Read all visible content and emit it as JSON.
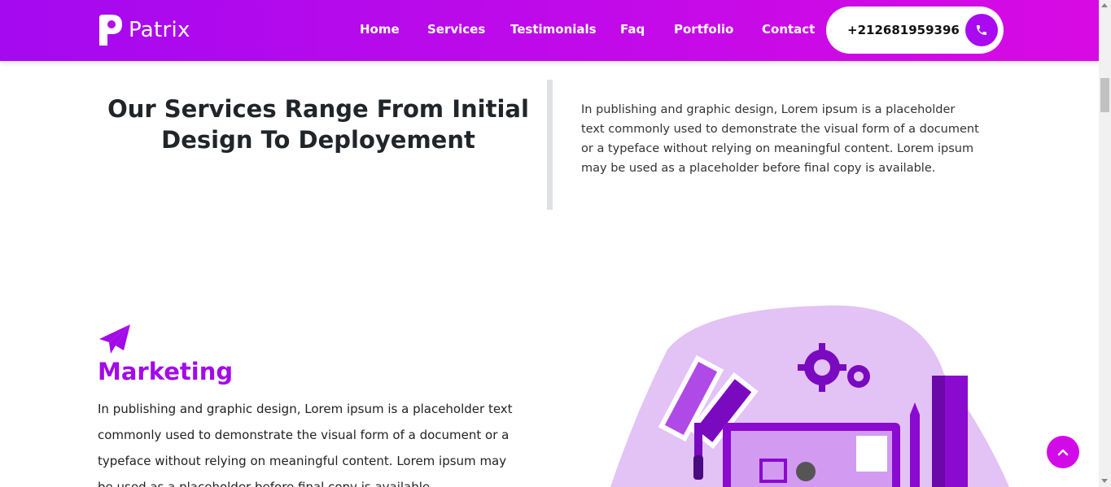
{
  "brand": {
    "name": "Patrix",
    "accent": "#a90af0",
    "accent_end": "#d80ae4"
  },
  "nav": {
    "items": [
      {
        "label": "Home"
      },
      {
        "label": "Services"
      },
      {
        "label": "Testimonials"
      },
      {
        "label": "Faq"
      },
      {
        "label": "Portfolio"
      },
      {
        "label": "Contact"
      }
    ],
    "phone": "+212681959396",
    "phone_icon": "phone-icon"
  },
  "intro": {
    "title": "Our Services Range From Initial Design To Deployement",
    "text": "In publishing and graphic design, Lorem ipsum is a placeholder text commonly used to demonstrate the visual form of a document or a typeface without relying on meaningful content. Lorem ipsum may be used as a placeholder before final copy is available."
  },
  "marketing": {
    "icon": "paper-plane-icon",
    "title": "Marketing",
    "text": "In publishing and graphic design, Lorem ipsum is a placeholder text commonly used to demonstrate the visual form of a document or a typeface without relying on meaningful content. Lorem ipsum may be used as a placeholder before final copy is available."
  },
  "back_to_top_icon": "chevron-up-icon"
}
